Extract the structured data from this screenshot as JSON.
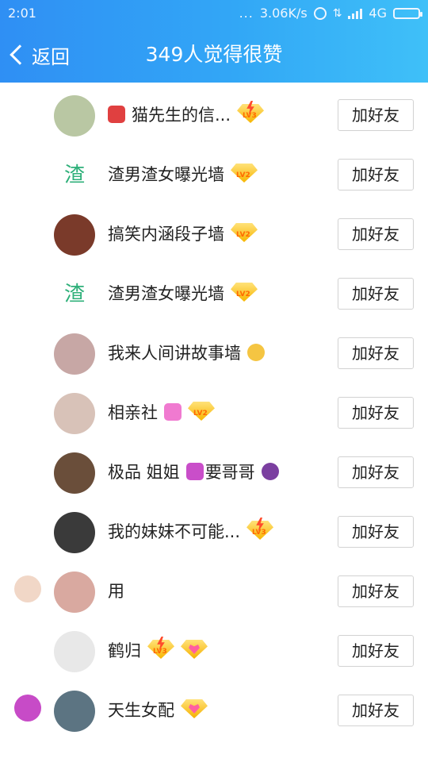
{
  "status_bar": {
    "time": "2:01",
    "dots": "...",
    "network_speed": "3.06K/s",
    "network_type": "4G"
  },
  "header": {
    "back_label": "返回",
    "title": "349人觉得很赞"
  },
  "add_friend_label": "加好友",
  "colors": {
    "header_start": "#2f8ff4",
    "header_end": "#3fc0f8",
    "badge_gold": "#f7b500",
    "bolt_red": "#ff4b2b",
    "zha_green": "#2fb07a"
  },
  "rows": [
    {
      "name": "猫先生的信...",
      "avatar_char": "",
      "avatar_color": "#b9c7a3",
      "emoji": "mailbox-icon",
      "badge": "lv3-bolt"
    },
    {
      "name": "渣男渣女曝光墙",
      "avatar_char": "渣",
      "avatar_color": "",
      "emoji": "",
      "badge": "lv2"
    },
    {
      "name": "搞笑内涵段子墙",
      "avatar_char": "",
      "avatar_color": "#7a3a2a",
      "emoji": "",
      "badge": "lv2"
    },
    {
      "name": "渣男渣女曝光墙",
      "avatar_char": "渣",
      "avatar_color": "",
      "emoji": "",
      "badge": "lv2"
    },
    {
      "name": "我来人间讲故事墙",
      "avatar_char": "",
      "avatar_color": "#c7a7a5",
      "emoji": "moon-icon",
      "badge": ""
    },
    {
      "name": "相亲社",
      "avatar_char": "",
      "avatar_color": "#d8c2b8",
      "emoji": "hearts-icon",
      "badge": "lv2"
    },
    {
      "name": "极品 姐姐",
      "avatar_char": "",
      "avatar_color": "#6a4e3a",
      "emoji": "restroom-icon",
      "name_suffix": "要哥哥",
      "emoji2": "eggplant-icon",
      "badge": ""
    },
    {
      "name": "我的妹妹不可能...",
      "avatar_char": "",
      "avatar_color": "#3a3a3a",
      "emoji": "",
      "badge": "lv3-bolt"
    },
    {
      "name": "用",
      "avatar_char": "",
      "avatar_color": "#d9a9a0",
      "emoji": "",
      "badge": "",
      "extra_avatar_color": "#f1d7c7"
    },
    {
      "name": "鹤归",
      "avatar_char": "",
      "avatar_color": "#e8e8e8",
      "emoji": "",
      "badge": "lv3-bolt",
      "badge2": "heart"
    },
    {
      "name": "天生女配",
      "avatar_char": "",
      "avatar_color": "#5c7482",
      "emoji": "",
      "badge": "heart",
      "extra_avatar_color": "#c74bc7"
    }
  ]
}
